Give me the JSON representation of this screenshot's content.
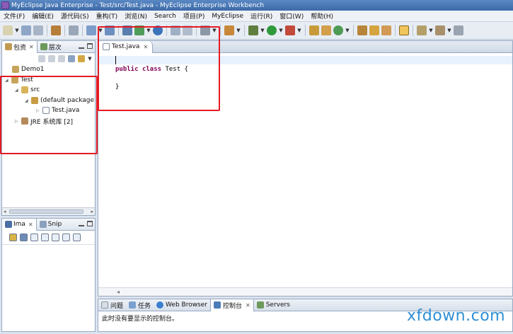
{
  "window": {
    "title": "MyEclipse Java Enterprise - Test/src/Test.java - MyEclipse Enterprise Workbench"
  },
  "menu": [
    "文件(F)",
    "编辑(E)",
    "源代码(S)",
    "重构(T)",
    "浏览(N)",
    "Search",
    "项目(P)",
    "MyEclipse",
    "运行(R)",
    "窗口(W)",
    "帮助(H)"
  ],
  "package_view": {
    "tabs": [
      "包资",
      "层次"
    ],
    "tree": [
      {
        "label": "Demo1"
      },
      {
        "label": "Test"
      },
      {
        "label": "src"
      },
      {
        "label": "(default package"
      },
      {
        "label": "Test.java"
      },
      {
        "label": "JRE 系统库 [2]"
      }
    ]
  },
  "image_view": {
    "tabs": [
      "Ima",
      "Snip"
    ]
  },
  "editor": {
    "tab": "Test.java",
    "code": [
      "",
      "public class Test {",
      "",
      "}"
    ],
    "keywords": [
      "public",
      "class"
    ],
    "class_rest": " Test {"
  },
  "console": {
    "tabs": [
      "问题",
      "任务",
      "Web Browser",
      "控制台",
      "Servers"
    ],
    "message": "此时没有要显示的控制台。"
  },
  "watermark": "xfdown.com",
  "colors": {
    "highlight": "#e51b24",
    "keyword": "#7f0055",
    "watermark": "#2f8fd4",
    "current_line": "#e8f2fe"
  }
}
